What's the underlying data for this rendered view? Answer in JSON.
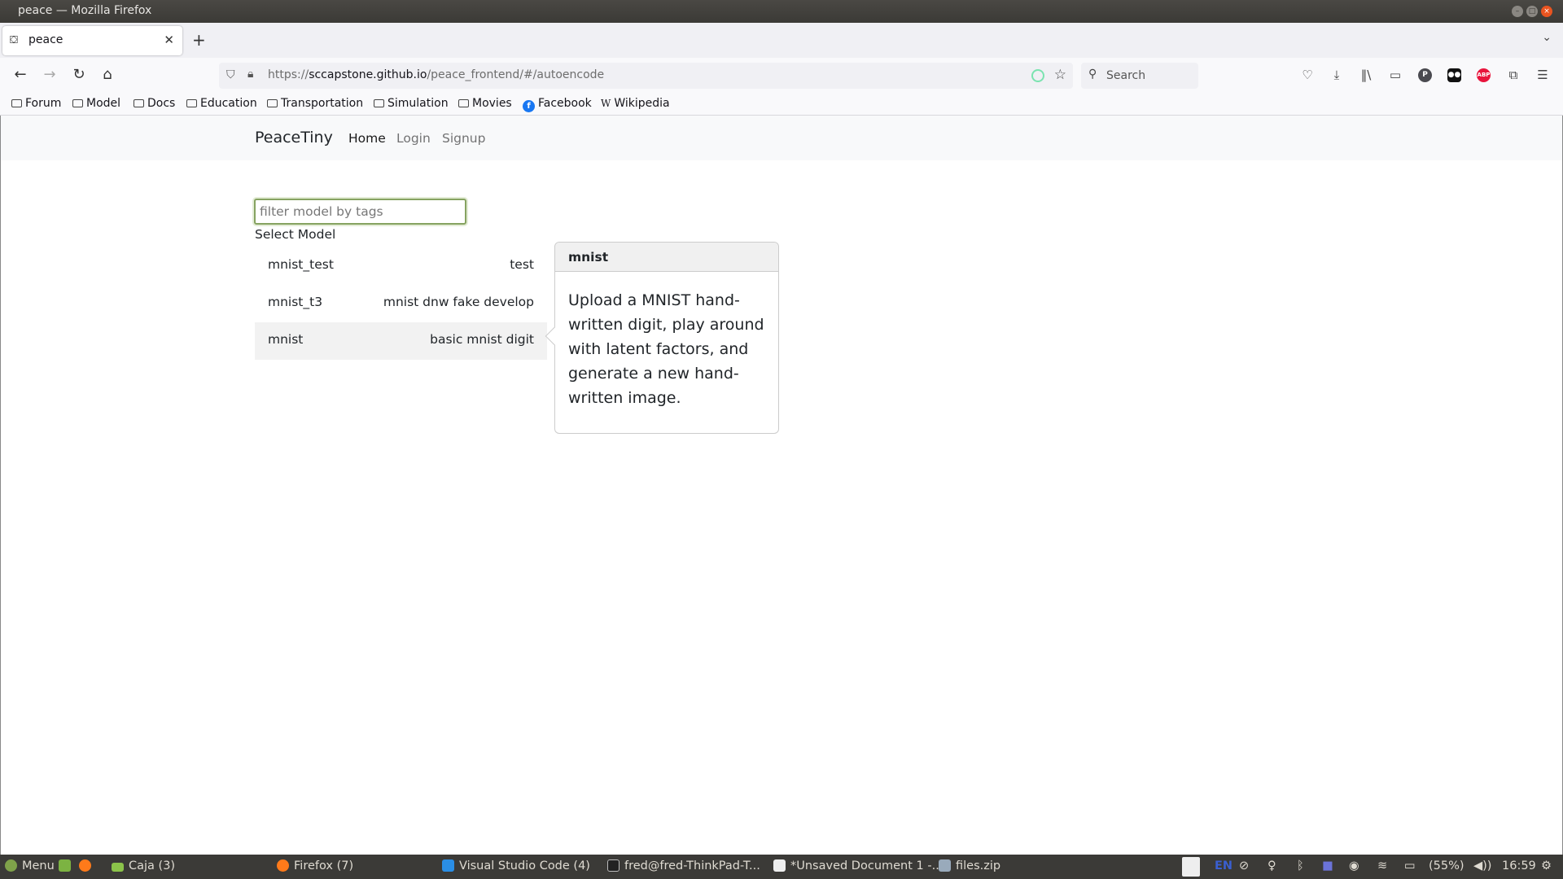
{
  "window": {
    "title": "peace — Mozilla Firefox",
    "controls": {
      "minimize": "–",
      "maximize": "□",
      "close": "×"
    }
  },
  "browser": {
    "tabs": [
      {
        "label": "peace",
        "favicon": "peace-favicon",
        "active": true
      }
    ],
    "new_tab_label": "+",
    "url": {
      "scheme": "https://",
      "host": "sccapstone.github.io",
      "path": "/peace_frontend/#/autoencode"
    },
    "search_placeholder": "Search",
    "bookmarks": [
      {
        "label": "Forum",
        "icon": "folder-icon"
      },
      {
        "label": "Model",
        "icon": "folder-icon"
      },
      {
        "label": "Docs",
        "icon": "folder-icon"
      },
      {
        "label": "Education",
        "icon": "folder-icon"
      },
      {
        "label": "Transportation",
        "icon": "folder-icon"
      },
      {
        "label": "Simulation",
        "icon": "folder-icon"
      },
      {
        "label": "Movies",
        "icon": "folder-icon"
      },
      {
        "label": "Facebook",
        "icon": "facebook-icon"
      },
      {
        "label": "Wikipedia",
        "icon": "wikipedia-icon"
      }
    ],
    "toolbar_icons": [
      "pocket-icon",
      "download-icon",
      "library-icon",
      "sidebar-icon",
      "p-extension-icon",
      "tampermonkey-icon",
      "adblock-plus-icon",
      "extensions-icon",
      "menu-icon"
    ],
    "abp_label": "ABP",
    "p_label": "P"
  },
  "app": {
    "brand": "PeaceTiny",
    "nav": [
      {
        "label": "Home",
        "active": true
      },
      {
        "label": "Login",
        "active": false
      },
      {
        "label": "Signup",
        "active": false
      }
    ],
    "filter": {
      "placeholder": "filter model by tags",
      "value": ""
    },
    "select_label": "Select Model",
    "models": [
      {
        "name": "mnist_test",
        "tags": "test",
        "selected": false
      },
      {
        "name": "mnist_t3",
        "tags": "mnist dnw fake develop",
        "selected": false
      },
      {
        "name": "mnist",
        "tags": "basic mnist digit",
        "selected": true
      }
    ],
    "popover": {
      "title": "mnist",
      "body": "Upload a MNIST hand-written digit, play around with latent factors, and generate a new hand-written image."
    }
  },
  "taskbar": {
    "menu_label": "Menu",
    "windows": [
      {
        "label": "Caja (3)"
      },
      {
        "label": "Firefox (7)"
      },
      {
        "label": "Visual Studio Code (4)"
      },
      {
        "label": "fred@fred-ThinkPad-T..."
      },
      {
        "label": "*Unsaved Document 1 -..."
      },
      {
        "label": "files.zip"
      }
    ],
    "tray": {
      "keyboard_layout": "EN",
      "battery": "(55%)",
      "clock": "16:59"
    }
  }
}
